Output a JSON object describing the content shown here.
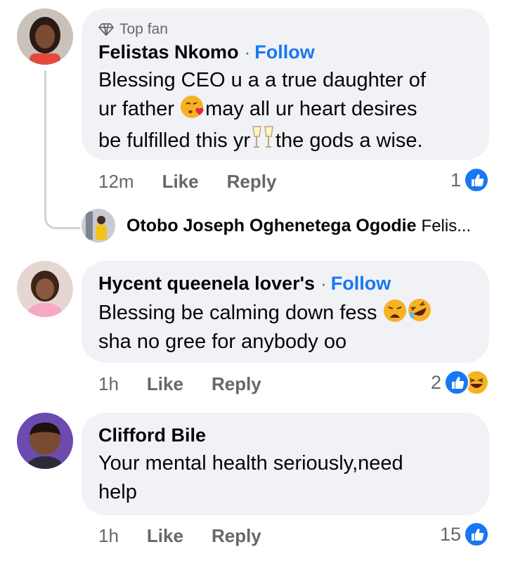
{
  "comments": [
    {
      "badge": "Top fan",
      "author": "Felistas Nkomo",
      "separator": "·",
      "follow_label": "Follow",
      "text_lines": [
        "Blessing CEO u a a true daughter of",
        "ur father ",
        "may all ur heart desires",
        "be fulfilled this yr",
        "the gods a wise."
      ],
      "time": "12m",
      "like_label": "Like",
      "reply_label": "Reply",
      "reaction_count": "1"
    },
    {
      "author": "Hycent queenela lover's",
      "separator": "·",
      "follow_label": "Follow",
      "text_lines": [
        "Blessing be calming down fess ",
        "sha no gree for anybody oo"
      ],
      "time": "1h",
      "like_label": "Like",
      "reply_label": "Reply",
      "reaction_count": "2"
    },
    {
      "author": "Clifford Bile",
      "text_lines": [
        "Your mental health seriously,need",
        "help"
      ],
      "time": "1h",
      "like_label": "Like",
      "reply_label": "Reply",
      "reaction_count": "15"
    }
  ],
  "reply_preview": {
    "author": "Otobo Joseph Oghenetega Ogodie",
    "snippet": "Felis..."
  },
  "colors": {
    "link_blue": "#1877f2",
    "bubble_bg": "#f0f2f5",
    "meta_gray": "#65676b",
    "haha_yellow": "#f7b125"
  }
}
